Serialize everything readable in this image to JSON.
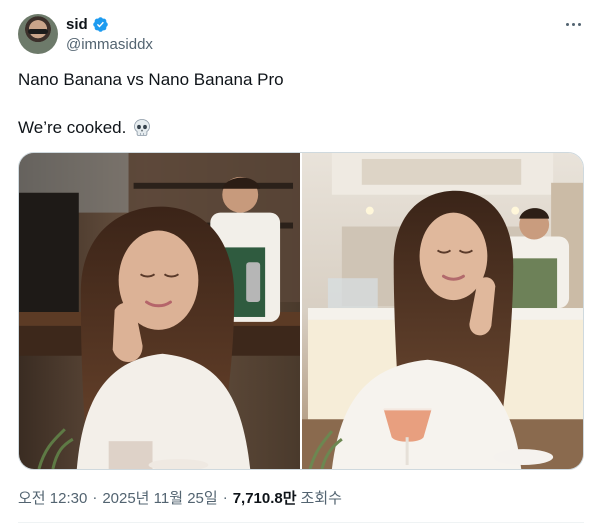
{
  "author": {
    "display_name": "sid",
    "handle": "@immasiddx",
    "verified": true
  },
  "tweet": {
    "line1": "Nano Banana vs Nano Banana Pro",
    "line2": "We’re cooked.",
    "emoji_icon": "skull-icon"
  },
  "media": {
    "count": 2,
    "images": [
      {
        "name": "left-photo"
      },
      {
        "name": "right-photo"
      }
    ]
  },
  "meta": {
    "time": "오전 12:30",
    "separator": "·",
    "date": "2025년 11월 25일",
    "views_count": "7,710.8만",
    "views_label": "조회수"
  },
  "colors": {
    "text_primary": "#0f1419",
    "text_secondary": "#536471",
    "verified_blue": "#1d9bf0",
    "border": "#cfd9de"
  },
  "icons": [
    "verified-badge-icon",
    "more-options-icon",
    "skull-icon"
  ]
}
